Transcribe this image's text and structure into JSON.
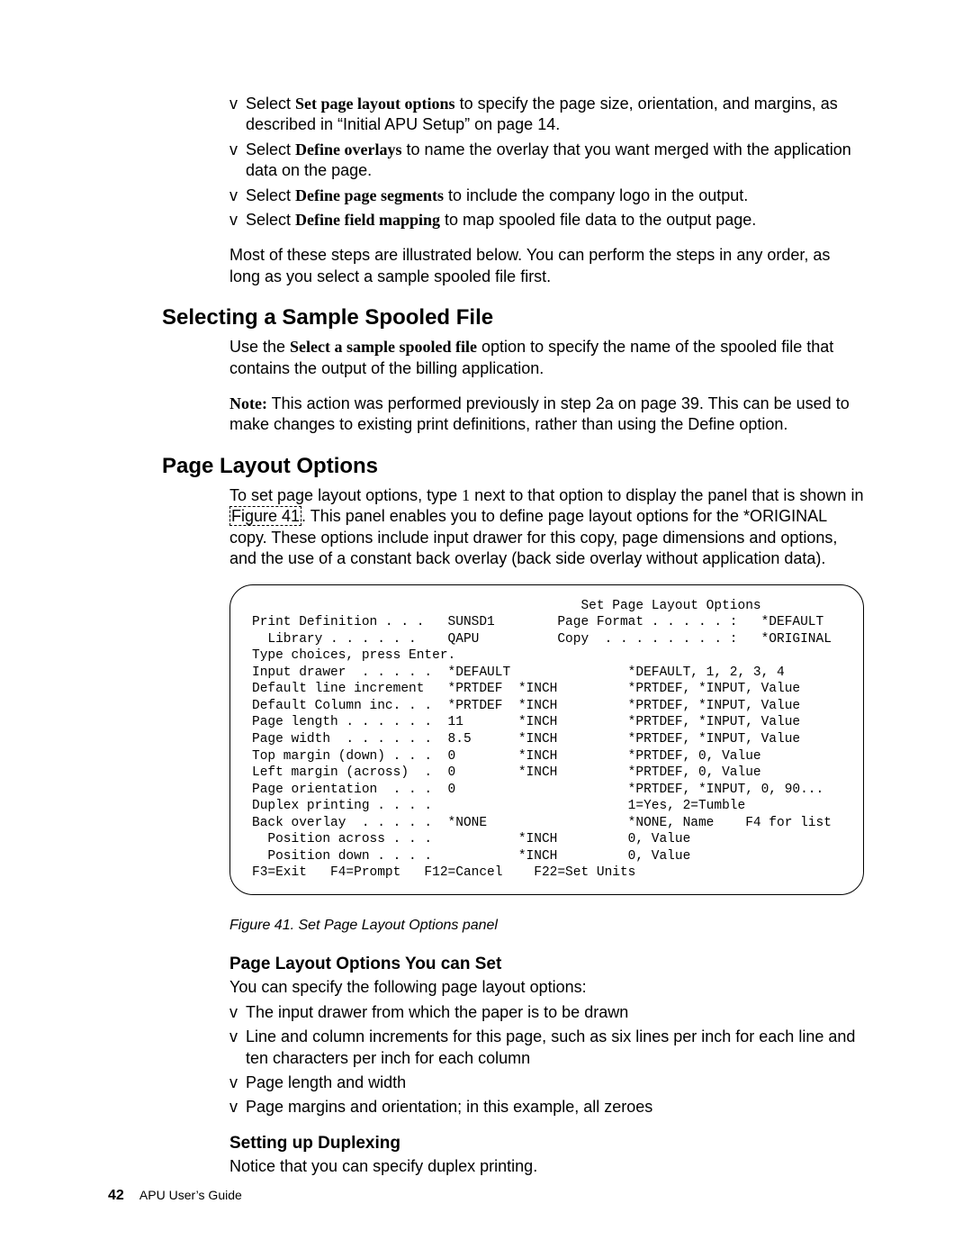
{
  "intro_bullets": [
    {
      "prefix": "Select ",
      "bold": "Set page layout options",
      "rest": " to specify the page size, orientation, and margins, as described in “Initial APU Setup” on page 14."
    },
    {
      "prefix": "Select ",
      "bold": "Define overlays",
      "rest": " to name the overlay that you want merged with the application data on the page."
    },
    {
      "prefix": "Select ",
      "bold": "Define page segments",
      "rest": " to include the company logo in the output."
    },
    {
      "prefix": "Select ",
      "bold": "Define field mapping",
      "rest": " to map spooled file data to the output page."
    }
  ],
  "intro_after": "Most of these steps are illustrated below. You can perform the steps in any order, as long as you select a sample spooled file first.",
  "section_select": {
    "title": "Selecting a Sample Spooled File",
    "p1a": "Use the ",
    "p1b": "Select a sample spooled file",
    "p1c": " option to specify the name of the spooled file that contains the output of the billing application.",
    "note_label": "Note:",
    "note_text": " This action was performed previously in step 2a on page 39. This can be used to make changes to existing print definitions, rather than using the Define option."
  },
  "section_layout": {
    "title": "Page Layout Options",
    "p1a": "To set page layout options, type ",
    "p1b": "1",
    "p1c": " next to that option to display the panel that is shown in ",
    "xref": "Figure 41",
    "p1d": ". This panel enables you to define page layout options for the *ORIGINAL copy. These options include input drawer for this copy, page dimensions and options, and the use of a constant back overlay (back side overlay without application data)."
  },
  "terminal": "                                          Set Page Layout Options\nPrint Definition . . .   SUNSD1        Page Format . . . . . :   *DEFAULT\n  Library . . . . . .    QAPU          Copy  . . . . . . . . :   *ORIGINAL\nType choices, press Enter.\nInput drawer  . . . . .  *DEFAULT               *DEFAULT, 1, 2, 3, 4\nDefault line increment   *PRTDEF  *INCH         *PRTDEF, *INPUT, Value\nDefault Column inc. . .  *PRTDEF  *INCH         *PRTDEF, *INPUT, Value\nPage length . . . . . .  11       *INCH         *PRTDEF, *INPUT, Value\nPage width  . . . . . .  8.5      *INCH         *PRTDEF, *INPUT, Value\nTop margin (down) . . .  0        *INCH         *PRTDEF, 0, Value\nLeft margin (across)  .  0        *INCH         *PRTDEF, 0, Value\nPage orientation  . . .  0                      *PRTDEF, *INPUT, 0, 90...\nDuplex printing . . . .                         1=Yes, 2=Tumble\nBack overlay  . . . . .  *NONE                  *NONE, Name    F4 for list\n  Position across . . .           *INCH         0, Value\n  Position down . . . .           *INCH         0, Value\nF3=Exit   F4=Prompt   F12=Cancel    F22=Set Units",
  "figure_caption": "Figure 41. Set Page Layout Options panel",
  "section_set": {
    "title": "Page Layout Options You can Set",
    "intro": "You can specify the following page layout options:",
    "bullets": [
      "The input drawer from which the paper is to be drawn",
      "Line and column increments for this page, such as six lines per inch for each line and ten characters per inch for each column",
      "Page length and width",
      "Page margins and orientation; in this example, all zeroes"
    ]
  },
  "section_duplex": {
    "title": "Setting up Duplexing",
    "text": "Notice that you can specify duplex printing."
  },
  "footer": {
    "page_number": "42",
    "doc_title": "APU User’s Guide"
  }
}
